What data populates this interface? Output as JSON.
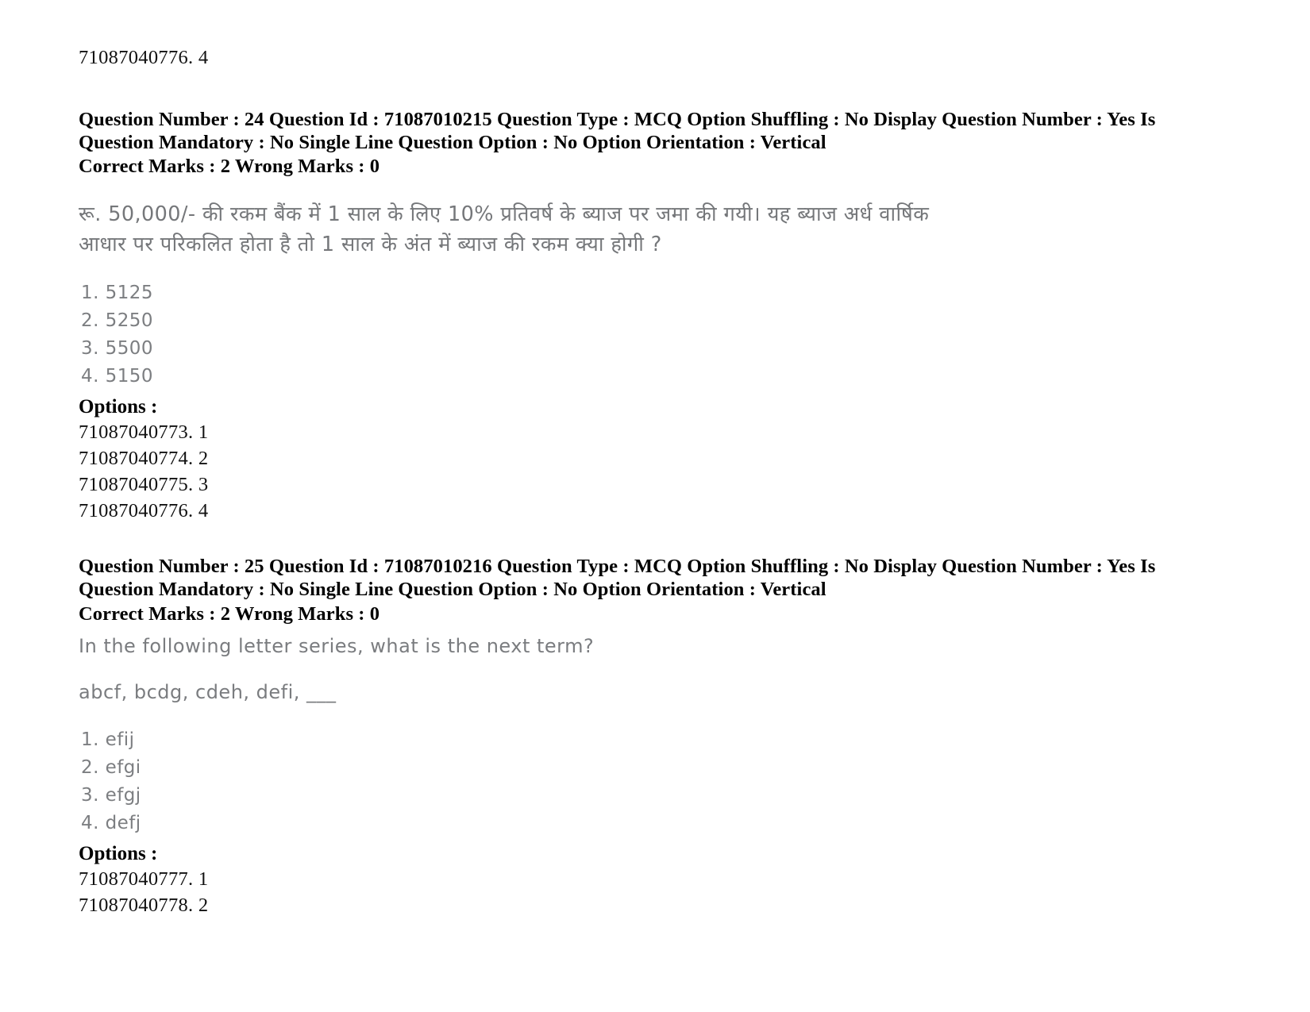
{
  "page": {
    "top_reference": "71087040776. 4"
  },
  "questions": [
    {
      "meta_line_1": "Question Number : 24 Question Id : 71087010215 Question Type : MCQ Option Shuffling : No Display Question Number : Yes Is",
      "meta_line_2": "Question Mandatory : No Single Line Question Option : No Option Orientation : Vertical",
      "marks_line": "Correct Marks : 2 Wrong Marks : 0",
      "body_lines": [
        "रू. 50,000/- की रकम बैंक में 1 साल के लिए 10% प्रतिवर्ष के ब्याज पर जमा की गयी। यह ब्याज अर्ध वार्षिक",
        "आधार पर परिकलित होता है तो 1 साल के अंत में ब्याज की रकम क्या होगी ?"
      ],
      "choices": [
        "1. 5125",
        "2. 5250",
        "3. 5500",
        "4. 5150"
      ],
      "options_label": "Options :",
      "option_ids": [
        "71087040773. 1",
        "71087040774. 2",
        "71087040775. 3",
        "71087040776. 4"
      ]
    },
    {
      "meta_line_1": "Question Number : 25 Question Id : 71087010216 Question Type : MCQ Option Shuffling : No Display Question Number : Yes Is",
      "meta_line_2": "Question Mandatory : No Single Line Question Option : No Option Orientation : Vertical",
      "marks_line": "Correct Marks : 2 Wrong Marks : 0",
      "body_lines": [
        "In the following letter series, what is the next term?",
        "abcf, bcdg, cdeh, defi, ___"
      ],
      "choices": [
        "1. efij",
        "2. efgi",
        "3. efgj",
        "4. defj"
      ],
      "options_label": "Options :",
      "option_ids": [
        "71087040777. 1",
        "71087040778. 2"
      ]
    }
  ]
}
